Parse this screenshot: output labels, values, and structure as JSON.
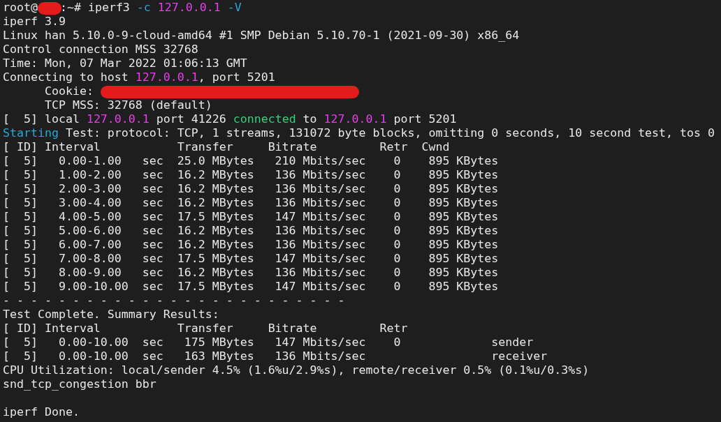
{
  "terminal": {
    "lines": [
      {
        "segments": [
          {
            "text": "root@"
          },
          {
            "kind": "redaction"
          },
          {
            "text": ":~# iperf3 "
          },
          {
            "text": "-c",
            "color": "#2aa7d8"
          },
          {
            "text": " 127.0.0.1",
            "color": "#e83ee8"
          },
          {
            "text": " -V",
            "color": "#2aa7d8"
          }
        ]
      },
      {
        "segments": [
          {
            "text": "iperf 3.9"
          }
        ]
      },
      {
        "segments": [
          {
            "text": "Linux han 5.10.0-9-cloud-amd64 #1 SMP Debian 5.10.70-1 (2021-09-30) x86_64"
          }
        ]
      },
      {
        "segments": [
          {
            "text": "Control connection MSS 32768"
          }
        ]
      },
      {
        "segments": [
          {
            "text": "Time: Mon, 07 Mar 2022 01:06:13 GMT"
          }
        ]
      },
      {
        "segments": [
          {
            "text": "Connecting to host "
          },
          {
            "text": "127.0.0.1",
            "color": "#e83ee8"
          },
          {
            "text": ", port 5201"
          }
        ]
      },
      {
        "segments": [
          {
            "text": "      Cookie: "
          },
          {
            "kind": "redaction"
          }
        ]
      },
      {
        "segments": [
          {
            "text": "      TCP MSS: 32768 (default)"
          }
        ]
      },
      {
        "segments": [
          {
            "text": "[  5] local "
          },
          {
            "text": "127.0.0.1",
            "color": "#e83ee8"
          },
          {
            "text": " port 41226 "
          },
          {
            "text": "connected",
            "color": "#2ed47c"
          },
          {
            "text": " to "
          },
          {
            "text": "127.0.0.1",
            "color": "#e83ee8"
          },
          {
            "text": " port 5201"
          }
        ]
      },
      {
        "segments": [
          {
            "text": "Starting",
            "color": "#2aa7d8"
          },
          {
            "text": " Test: protocol: TCP, 1 streams, 131072 byte blocks, omitting 0 seconds, 10 second test, tos 0"
          }
        ]
      },
      {
        "segments": [
          {
            "text": "[ ID] Interval           Transfer     Bitrate         Retr  Cwnd"
          }
        ]
      },
      {
        "segments": [
          {
            "text": "[  5]   0.00-1.00   sec  25.0 MBytes   210 Mbits/sec    0    895 KBytes"
          }
        ]
      },
      {
        "segments": [
          {
            "text": "[  5]   1.00-2.00   sec  16.2 MBytes   136 Mbits/sec    0    895 KBytes"
          }
        ]
      },
      {
        "segments": [
          {
            "text": "[  5]   2.00-3.00   sec  16.2 MBytes   136 Mbits/sec    0    895 KBytes"
          }
        ]
      },
      {
        "segments": [
          {
            "text": "[  5]   3.00-4.00   sec  16.2 MBytes   136 Mbits/sec    0    895 KBytes"
          }
        ]
      },
      {
        "segments": [
          {
            "text": "[  5]   4.00-5.00   sec  17.5 MBytes   147 Mbits/sec    0    895 KBytes"
          }
        ]
      },
      {
        "segments": [
          {
            "text": "[  5]   5.00-6.00   sec  16.2 MBytes   136 Mbits/sec    0    895 KBytes"
          }
        ]
      },
      {
        "segments": [
          {
            "text": "[  5]   6.00-7.00   sec  16.2 MBytes   136 Mbits/sec    0    895 KBytes"
          }
        ]
      },
      {
        "segments": [
          {
            "text": "[  5]   7.00-8.00   sec  17.5 MBytes   147 Mbits/sec    0    895 KBytes"
          }
        ]
      },
      {
        "segments": [
          {
            "text": "[  5]   8.00-9.00   sec  16.2 MBytes   136 Mbits/sec    0    895 KBytes"
          }
        ]
      },
      {
        "segments": [
          {
            "text": "[  5]   9.00-10.00  sec  17.5 MBytes   147 Mbits/sec    0    895 KBytes"
          }
        ]
      },
      {
        "segments": [
          {
            "text": "- - - - - - - - - - - - - - - - - - - - - - - - -"
          }
        ]
      },
      {
        "segments": [
          {
            "text": "Test Complete. Summary Results:"
          }
        ]
      },
      {
        "segments": [
          {
            "text": "[ ID] Interval           Transfer     Bitrate         Retr"
          }
        ]
      },
      {
        "segments": [
          {
            "text": "[  5]   0.00-10.00  sec   175 MBytes   147 Mbits/sec    0             sender"
          }
        ]
      },
      {
        "segments": [
          {
            "text": "[  5]   0.00-10.00  sec   163 MBytes   136 Mbits/sec                  receiver"
          }
        ]
      },
      {
        "segments": [
          {
            "text": "CPU Utilization: local/sender 4.5% (1.6%u/2.9%s), remote/receiver 0.5% (0.1%u/0.3%s)"
          }
        ]
      },
      {
        "segments": [
          {
            "text": "snd_tcp_congestion bbr"
          }
        ]
      },
      {
        "blank_before": true,
        "segments": [
          {
            "text": "iperf Done."
          }
        ]
      }
    ]
  }
}
